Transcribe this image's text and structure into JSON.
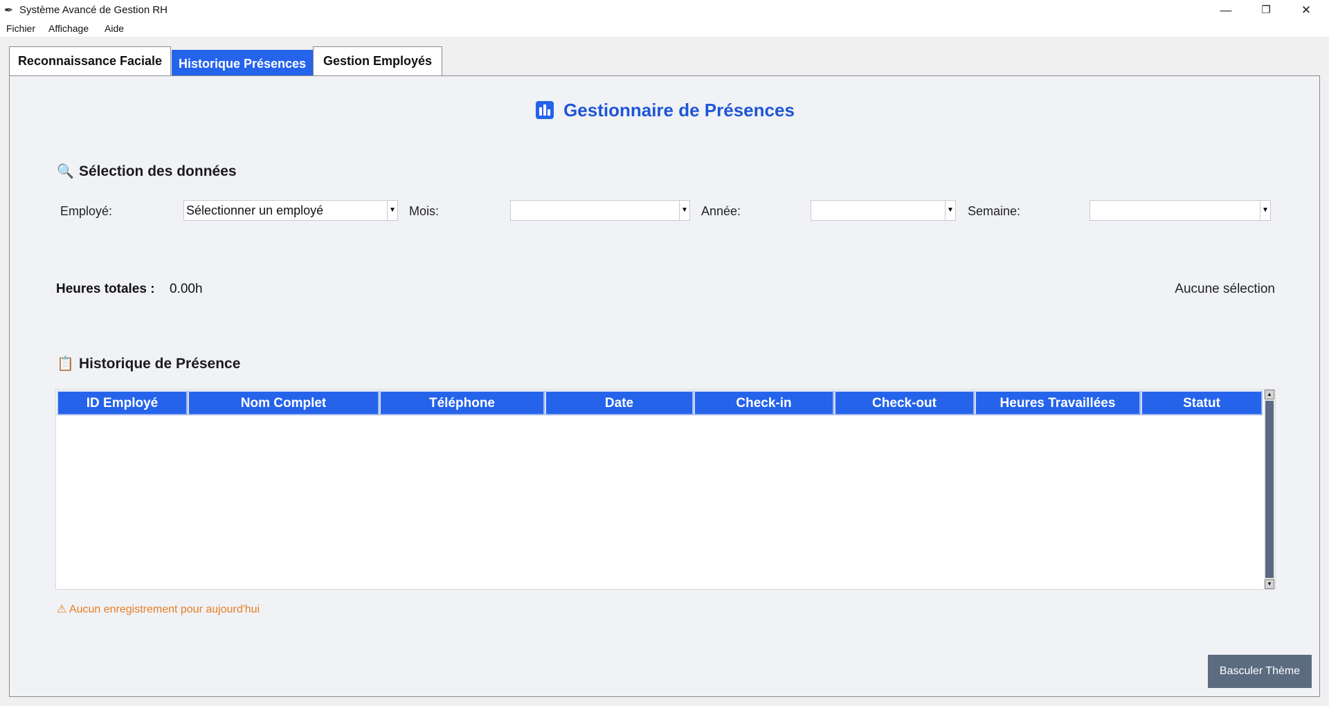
{
  "window": {
    "title": "Système Avancé de Gestion RH"
  },
  "menu": [
    "Fichier",
    "Affichage",
    "Aide"
  ],
  "tabs": [
    "Reconnaissance Faciale",
    "Historique Présences",
    "Gestion Employés"
  ],
  "page_title": "Gestionnaire de Présences",
  "selection": {
    "title": "Sélection des données",
    "employee_label": "Employé:",
    "employee_value": "Sélectionner un employé",
    "month_label": "Mois:",
    "month_value": "",
    "year_label": "Année:",
    "year_value": "",
    "week_label": "Semaine:",
    "week_value": ""
  },
  "totals": {
    "label": "Heures totales :",
    "value": "0.00h",
    "status": "Aucune sélection"
  },
  "history": {
    "title": "Historique de Présence",
    "columns": [
      "ID Employé",
      "Nom Complet",
      "Téléphone",
      "Date",
      "Check-in",
      "Check-out",
      "Heures Travaillées",
      "Statut"
    ],
    "rows": []
  },
  "warning": "Aucun enregistrement pour aujourd'hui",
  "theme_button": "Basculer Thème",
  "colors": {
    "accent": "#2563eb",
    "title": "#1f56d6",
    "warning": "#e67e22",
    "theme_button": "#5b6b80"
  }
}
